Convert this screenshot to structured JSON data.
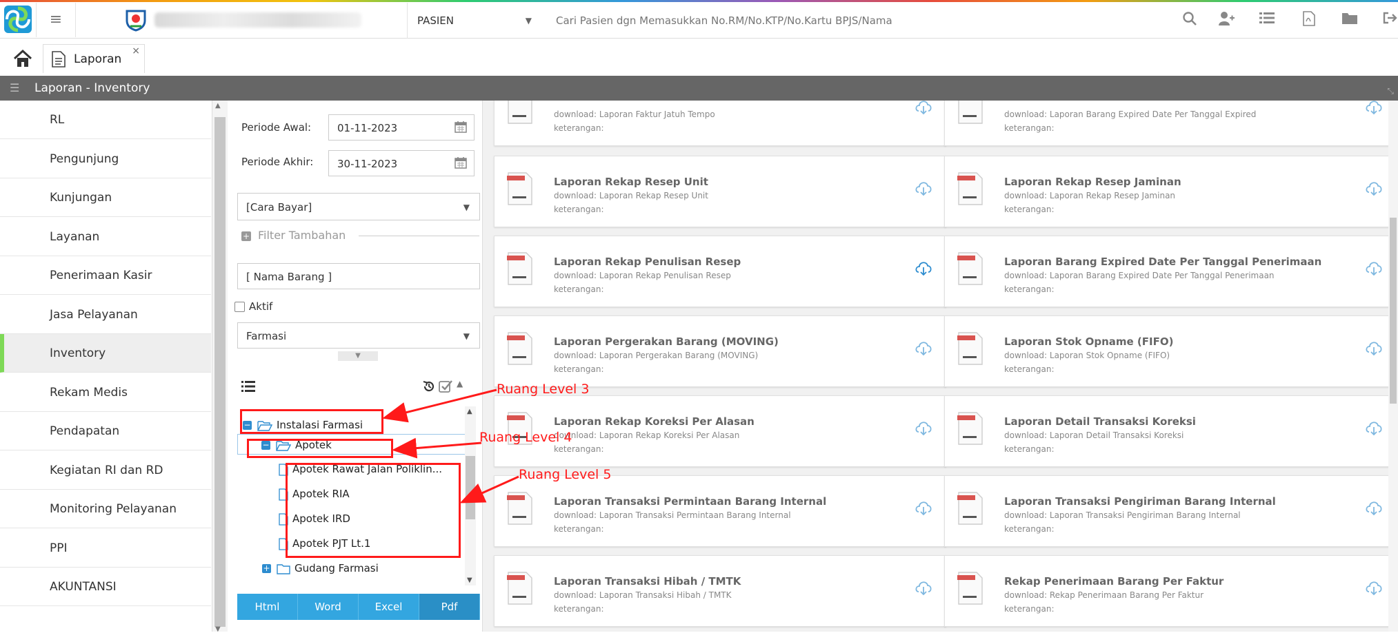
{
  "topbar": {
    "pasien_label": "PASIEN",
    "search_placeholder": "Cari Pasien dgn Memasukkan No.RM/No.KTP/No.Kartu BPJS/Nama",
    "icons": [
      "search-icon",
      "add-user-icon",
      "list-icon",
      "pdf-icon",
      "folder-icon",
      "logout-icon"
    ]
  },
  "tabs": {
    "active_label": "Laporan",
    "close": "×"
  },
  "page_title": "Laporan - Inventory",
  "sidebar": {
    "items": [
      {
        "label": "RL"
      },
      {
        "label": "Pengunjung"
      },
      {
        "label": "Kunjungan"
      },
      {
        "label": "Layanan"
      },
      {
        "label": "Penerimaan Kasir"
      },
      {
        "label": "Jasa Pelayanan"
      },
      {
        "label": "Inventory",
        "active": true
      },
      {
        "label": "Rekam Medis"
      },
      {
        "label": "Pendapatan"
      },
      {
        "label": "Kegiatan RI dan RD"
      },
      {
        "label": "Monitoring Pelayanan"
      },
      {
        "label": "PPI"
      },
      {
        "label": "AKUNTANSI"
      }
    ]
  },
  "filter": {
    "periode_awal_label": "Periode Awal:",
    "periode_awal_value": "01-11-2023",
    "periode_akhir_label": "Periode Akhir:",
    "periode_akhir_value": "30-11-2023",
    "cara_bayar": "[Cara Bayar]",
    "filter_tambahan": "Filter Tambahan",
    "nama_barang_placeholder": "[ Nama Barang ]",
    "aktif_label": "Aktif",
    "aktif_checked": false,
    "instalasi": "Farmasi"
  },
  "tree": {
    "nodes": [
      {
        "label": "Instalasi Farmasi",
        "level": 0,
        "expanded": true
      },
      {
        "label": "Apotek",
        "level": 1,
        "expanded": true,
        "selected": true
      },
      {
        "label": "Apotek Rawat Jalan Poliklin...",
        "level": 2
      },
      {
        "label": "Apotek RIA",
        "level": 2
      },
      {
        "label": "Apotek IRD",
        "level": 2
      },
      {
        "label": "Apotek PJT Lt.1",
        "level": 2
      },
      {
        "label": "Gudang Farmasi",
        "level": 1,
        "expanded": false
      }
    ]
  },
  "export_buttons": [
    "Html",
    "Word",
    "Excel",
    "Pdf"
  ],
  "annotations": {
    "level3": "Ruang Level 3",
    "level4": "Ruang Level 4",
    "level5": "Ruang Level 5"
  },
  "reports": [
    {
      "title": "",
      "download": "download: Laporan Faktur Jatuh Tempo",
      "ket": "keterangan:"
    },
    {
      "title": "",
      "download": "download: Laporan Barang Expired Date Per Tanggal Expired",
      "ket": "keterangan:"
    },
    {
      "title": "Laporan Rekap Resep Unit",
      "download": "download: Laporan Rekap Resep Unit",
      "ket": "keterangan:"
    },
    {
      "title": "Laporan Rekap Resep Jaminan",
      "download": "download: Laporan Rekap Resep Jaminan",
      "ket": "keterangan:"
    },
    {
      "title": "Laporan Rekap Penulisan Resep",
      "download": "download: Laporan Rekap Penulisan Resep",
      "ket": "keterangan:"
    },
    {
      "title": "Laporan Barang Expired Date Per Tanggal Penerimaan",
      "download": "download: Laporan Barang Expired Date Per Tanggal Penerimaan",
      "ket": "keterangan:"
    },
    {
      "title": "Laporan Pergerakan Barang (MOVING)",
      "download": "download: Laporan Pergerakan Barang (MOVING)",
      "ket": "keterangan:"
    },
    {
      "title": "Laporan Stok Opname (FIFO)",
      "download": "download: Laporan Stok Opname (FIFO)",
      "ket": "keterangan:"
    },
    {
      "title": "Laporan Rekap Koreksi Per Alasan",
      "download": "download: Laporan Rekap Koreksi Per Alasan",
      "ket": "keterangan:"
    },
    {
      "title": "Laporan Detail Transaksi Koreksi",
      "download": "download: Laporan Detail Transaksi Koreksi",
      "ket": "keterangan:"
    },
    {
      "title": "Laporan Transaksi Permintaan Barang Internal",
      "download": "download: Laporan Transaksi Permintaan Barang Internal",
      "ket": "keterangan:"
    },
    {
      "title": "Laporan Transaksi Pengiriman Barang Internal",
      "download": "download: Laporan Transaksi Pengiriman Barang Internal",
      "ket": "keterangan:"
    },
    {
      "title": "Laporan Transaksi Hibah / TMTK",
      "download": "download: Laporan Transaksi Hibah / TMTK",
      "ket": "keterangan:"
    },
    {
      "title": "Rekap Penerimaan Barang Per Faktur",
      "download": "download: Rekap Penerimaan Barang Per Faktur",
      "ket": "keterangan:"
    }
  ],
  "colors": {
    "accent_blue": "#33a6e0",
    "active_nav": "#7ed957",
    "annotation_red": "#ff1a1a",
    "header_gray": "#666666"
  }
}
